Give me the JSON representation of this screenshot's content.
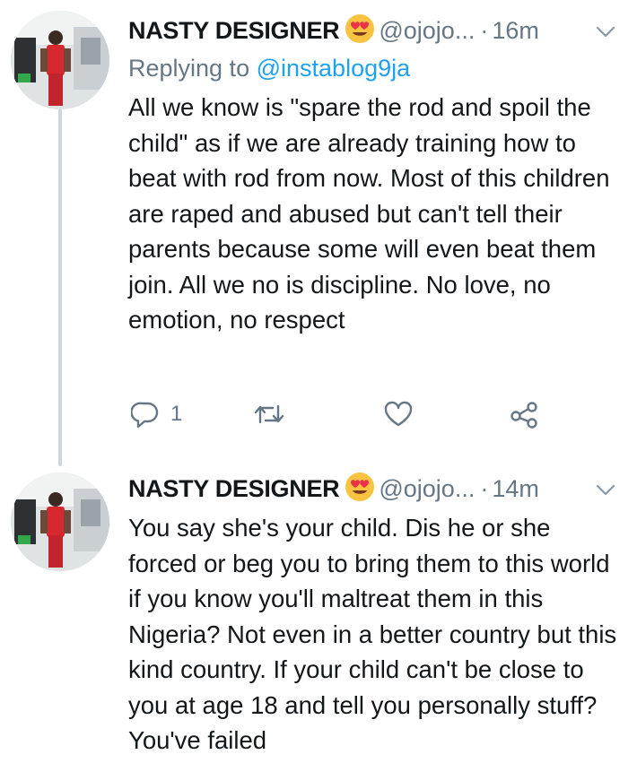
{
  "tweets": [
    {
      "author_name": "NASTY DESIGNER",
      "handle": "@ojojo...",
      "separator": "·",
      "time": "16m",
      "replying_prefix": "Replying to",
      "replying_handle": "@instablog9ja",
      "text": "All we know is \"spare the rod and spoil the child\" as if we are already training how to beat with rod from now. Most of this children are raped and abused but can't tell their parents because some will even beat them join. All we no is discipline. No love, no emotion, no respect",
      "reply_count": "1",
      "icons": [
        "reply-icon",
        "retweet-icon",
        "like-icon",
        "share-icon"
      ]
    },
    {
      "author_name": "NASTY DESIGNER",
      "handle": "@ojojo...",
      "separator": "·",
      "time": "14m",
      "text": "You say she's your child. Dis he or she forced or beg you to bring them to this world if you know you'll maltreat them in this Nigeria? Not even in a better country but this kind country. If your child can't be close to you at age 18 and tell you personally stuff? You've failed"
    }
  ],
  "colors": {
    "link": "#1da1f2",
    "secondary": "#657786",
    "thread": "#ccd6dd",
    "emoji": "#f7c341"
  }
}
